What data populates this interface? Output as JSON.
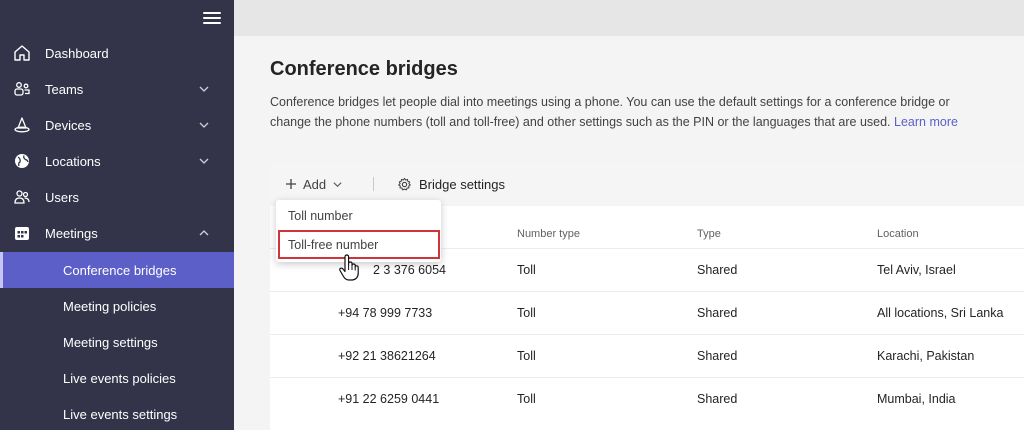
{
  "sidebar": {
    "items": [
      {
        "label": "Dashboard",
        "icon": "home-icon"
      },
      {
        "label": "Teams",
        "icon": "teams-icon"
      },
      {
        "label": "Devices",
        "icon": "devices-icon"
      },
      {
        "label": "Locations",
        "icon": "globe-icon"
      },
      {
        "label": "Users",
        "icon": "users-icon"
      },
      {
        "label": "Meetings",
        "icon": "calendar-icon"
      }
    ],
    "meetings_sub": [
      {
        "label": "Conference bridges",
        "active": true
      },
      {
        "label": "Meeting policies"
      },
      {
        "label": "Meeting settings"
      },
      {
        "label": "Live events policies"
      },
      {
        "label": "Live events settings"
      }
    ]
  },
  "page": {
    "title": "Conference bridges",
    "description": "Conference bridges let people dial into meetings using a phone. You can use the default settings for a conference bridge or change the phone numbers (toll and toll-free) and other settings such as the PIN or the languages that are used.",
    "learn_more": "Learn more"
  },
  "toolbar": {
    "add_label": "Add",
    "bridge_settings_label": "Bridge settings"
  },
  "dropdown": {
    "options": [
      "Toll number",
      "Toll-free number"
    ]
  },
  "table": {
    "columns": [
      "Number type",
      "Type",
      "Location"
    ],
    "rows": [
      {
        "number": "2 3 376 6054",
        "number_type": "Toll",
        "type": "Shared",
        "location": "Tel Aviv, Israel"
      },
      {
        "number": "+94 78 999 7733",
        "number_type": "Toll",
        "type": "Shared",
        "location": "All locations, Sri Lanka"
      },
      {
        "number": "+92 21 38621264",
        "number_type": "Toll",
        "type": "Shared",
        "location": "Karachi, Pakistan"
      },
      {
        "number": "+91 22 6259 0441",
        "number_type": "Toll",
        "type": "Shared",
        "location": "Mumbai, India"
      }
    ]
  },
  "colors": {
    "sidebar_bg": "#33344a",
    "active_item": "#5b5fc7",
    "highlight_border": "#d13438",
    "link": "#5b5fc7"
  }
}
